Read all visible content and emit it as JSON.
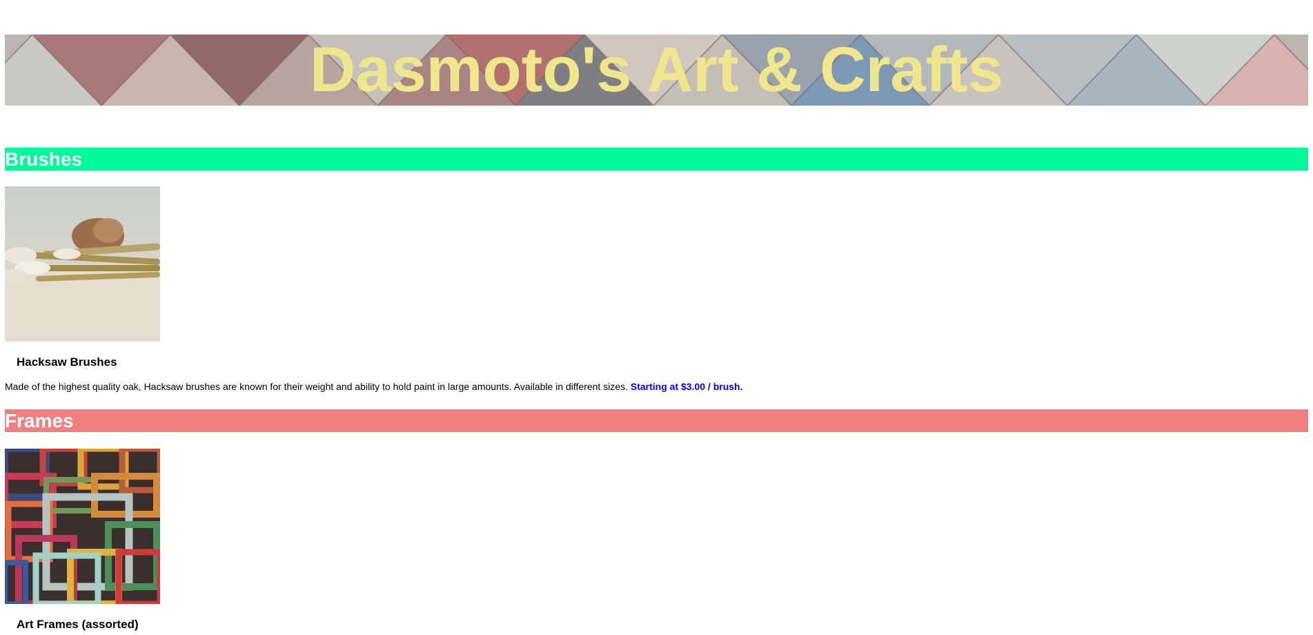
{
  "header": {
    "title": "Dasmoto's Art & Crafts",
    "title_color": "#f0e68c"
  },
  "brushes": {
    "heading": "Brushes",
    "heading_bg": "#00fa9a",
    "product": {
      "image_alt": "brushes photo",
      "name": "Hacksaw Brushes",
      "description": "Made of the highest quality oak, Hacksaw brushes are known for their weight and ability to hold paint in large amounts. Available in different sizes.",
      "price": "Starting at $3.00 / brush.",
      "price_color": "#0000ff"
    }
  },
  "frames": {
    "heading": "Frames",
    "heading_bg": "#f08080",
    "product": {
      "image_alt": "frames photo",
      "name": "Art Frames (assorted)"
    }
  }
}
